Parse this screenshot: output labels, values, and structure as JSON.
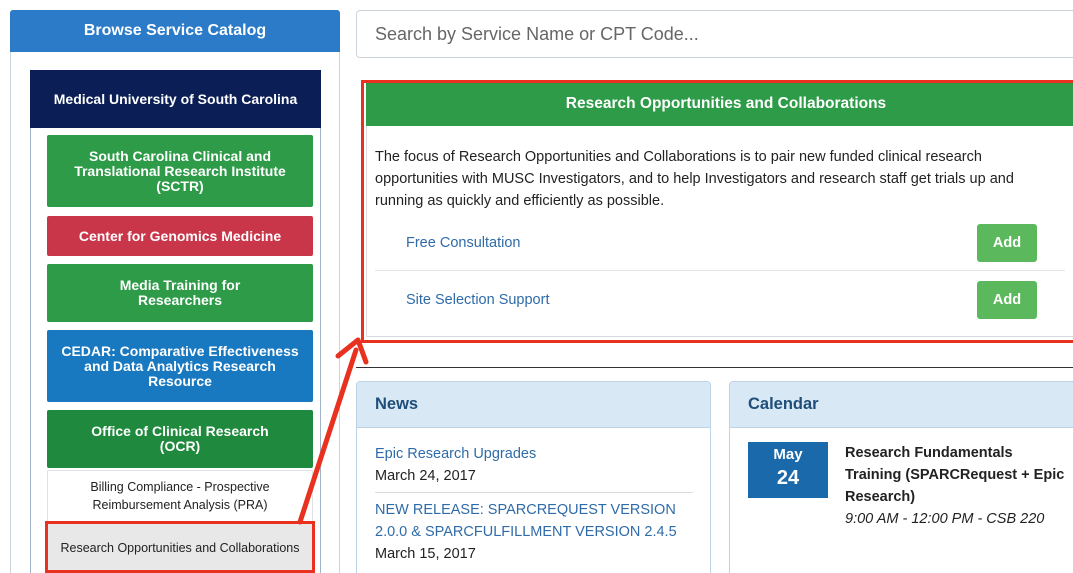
{
  "sidebar": {
    "header": "Browse Service Catalog",
    "root": "Medical University of South Carolina",
    "items": [
      {
        "label": "South Carolina Clinical and Translational Research Institute (SCTR)",
        "color": "#2d9b48"
      },
      {
        "label": "Center for Genomics Medicine",
        "color": "#c9364a"
      },
      {
        "label": "Media Training for Researchers",
        "color": "#2d9b48"
      },
      {
        "label": "CEDAR: Comparative Effectiveness and Data Analytics Research Resource",
        "color": "#1878c0"
      },
      {
        "label": "Office of Clinical Research (OCR)",
        "color": "#1f8a3d"
      }
    ],
    "sub_items": [
      {
        "label": "Billing Compliance - Prospective Reimbursement Analysis (PRA)"
      },
      {
        "label": "Research Opportunities and Collaborations"
      }
    ]
  },
  "search": {
    "placeholder": "Search by Service Name or CPT Code..."
  },
  "service": {
    "title": "Research Opportunities and Collaborations",
    "description": "The focus of Research Opportunities and Collaborations is to pair new funded clinical research opportunities with MUSC Investigators, and to help Investigators and research staff get trials up and running as quickly and efficiently as possible.",
    "rows": [
      {
        "name": "Free Consultation",
        "button": "Add"
      },
      {
        "name": "Site Selection Support",
        "button": "Add"
      }
    ]
  },
  "news": {
    "title": "News",
    "items": [
      {
        "headline": "Epic Research Upgrades",
        "date": "March 24, 2017"
      },
      {
        "headline": "NEW RELEASE: SPARCREQUEST VERSION 2.0.0 & SPARCFULFILLMENT VERSION 2.4.5",
        "date": "March 15, 2017"
      }
    ]
  },
  "calendar": {
    "title": "Calendar",
    "event": {
      "month": "May",
      "day": "24",
      "title": "Research Fundamentals Training (SPARCRequest + Epic Research)",
      "time": "9:00 AM - 12:00 PM - CSB 220"
    }
  },
  "colors": {
    "annotation": "#e8321f",
    "primary_blue": "#2b7bc9",
    "green": "#2d9b48"
  }
}
